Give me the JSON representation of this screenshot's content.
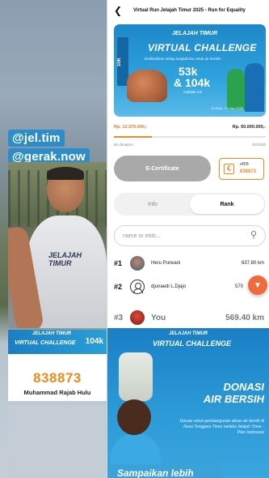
{
  "left": {
    "handles": [
      "@jel.tim",
      "@gerak.now"
    ],
    "shirt_text": "JELAJAH TIMUR",
    "mini_card": {
      "brand": "JELAJAH TIMUR",
      "title": "VIRTUAL CHALLENGE",
      "distance": "104k",
      "code": "838873",
      "name": "Muhammad Rajab Hulu"
    }
  },
  "app": {
    "title": "Virtual Run Jelajah Timur 2025 - Run for Equality",
    "banner": {
      "brand": "JELAJAH TIMUR",
      "title": "VIRTUAL CHALLENGE",
      "subtitle": "Dedikasikan setiap langkahmu untuk air bersih!",
      "side_label": "10K",
      "distance_1": "53k",
      "distance_2": "& 104k",
      "multiple": "multiple run",
      "date": "10 Sept - 10 Nov 2025"
    },
    "raised": "Rp. 12.375.000,-",
    "target": "Rp. 50.000.000,-",
    "progress_percent": 24.75,
    "donations": "80 donators",
    "days": "30/11/00",
    "certificate_label": "E-Certificate",
    "ebib": {
      "label": "eBIB",
      "code": "838873"
    },
    "tabs": [
      {
        "label": "Info",
        "active": false
      },
      {
        "label": "Rank",
        "active": true
      }
    ],
    "search_placeholder": "name or ebib...",
    "ranking": [
      {
        "rank": "#1",
        "name": "Heru Purwani",
        "distance": "637.80 km"
      },
      {
        "rank": "#2",
        "name": "djunaedi L.Djajo",
        "distance": "570"
      },
      {
        "rank": "#3",
        "name": "You",
        "distance": "569.40 km"
      }
    ]
  },
  "poster": {
    "brand": "JELAJAH TIMUR",
    "title": "VIRTUAL CHALLENGE",
    "donasi_1": "DONASI",
    "donasi_2": "AIR BERSIH",
    "description": "Donasi untuk pembangunan akses air bersih di Nusa Tenggara Timur melalui Jelajah Timur - Plan Indonesia",
    "caption": "Sampaikan lebih"
  },
  "colors": {
    "brand_blue": "#1f86c8",
    "accent_orange": "#f08a1c",
    "fab": "#f26a3c"
  }
}
